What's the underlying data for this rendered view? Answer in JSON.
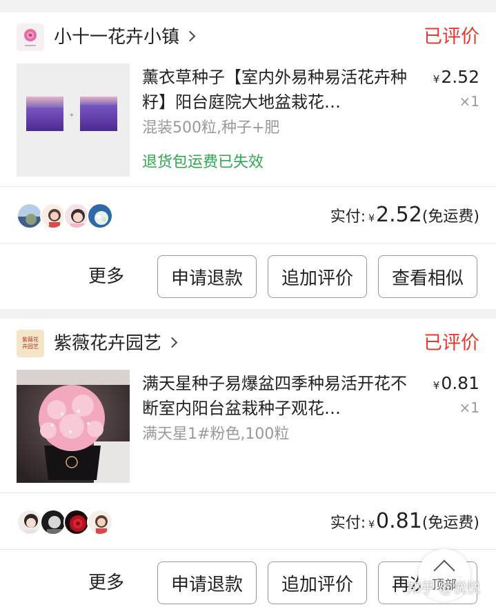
{
  "orders": [
    {
      "shop_name": "小十一花卉小镇",
      "status": "已评价",
      "product_title": "薰衣草种子【室内外易种易活花卉种籽】阳台庭院大地盆栽花…",
      "currency": "¥",
      "price": "2.52",
      "qty": "×1",
      "spec": "混装500粒,种子+肥",
      "refund_note": "退货包运费已失效",
      "paid_label": "实付:",
      "paid_amount": "2.52",
      "shipping_note": "(免运费)",
      "more_label": "更多",
      "buttons": [
        "申请退款",
        "追加评价",
        "查看相似"
      ]
    },
    {
      "shop_name": "紫薇花卉园艺",
      "shop_logo_text": "紫薇花卉园艺",
      "status": "已评价",
      "product_title": "满天星种子易爆盆四季种易活开花不断室内阳台盆栽种子观花…",
      "currency": "¥",
      "price": "0.81",
      "qty": "×1",
      "spec": "满天星1#粉色,100粒",
      "paid_label": "实付:",
      "paid_amount": "0.81",
      "shipping_note": "(免运费)",
      "more_label": "更多",
      "buttons": [
        "申请退款",
        "追加评价",
        "再次购买"
      ]
    }
  ],
  "float_button": {
    "label": "顶部"
  },
  "watermark": "知乎 @悦悦",
  "colors": {
    "status_red": "#e23a2e",
    "refund_green": "#2ea84f",
    "muted_gray": "#999999"
  }
}
